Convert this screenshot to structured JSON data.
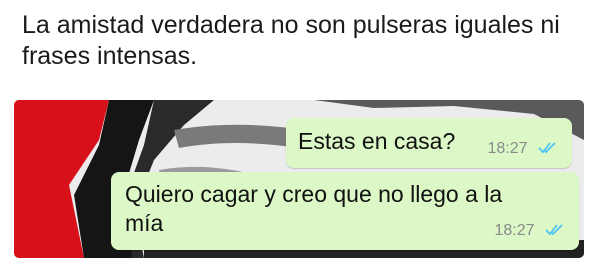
{
  "caption": "La amistad verdadera no son pulseras iguales ni frases intensas.",
  "messages": [
    {
      "text": "Estas en casa?",
      "time": "18:27",
      "status_icon": "double-check-read-icon"
    },
    {
      "text": "Quiero cagar y creo que no llego a la mía",
      "time": "18:27",
      "status_icon": "double-check-read-icon"
    }
  ],
  "colors": {
    "bubble_outgoing": "#dcf8c6",
    "read_ticks": "#4fc3f7",
    "timestamp": "#8a8a8a",
    "backdrop_red": "#d8101a"
  }
}
